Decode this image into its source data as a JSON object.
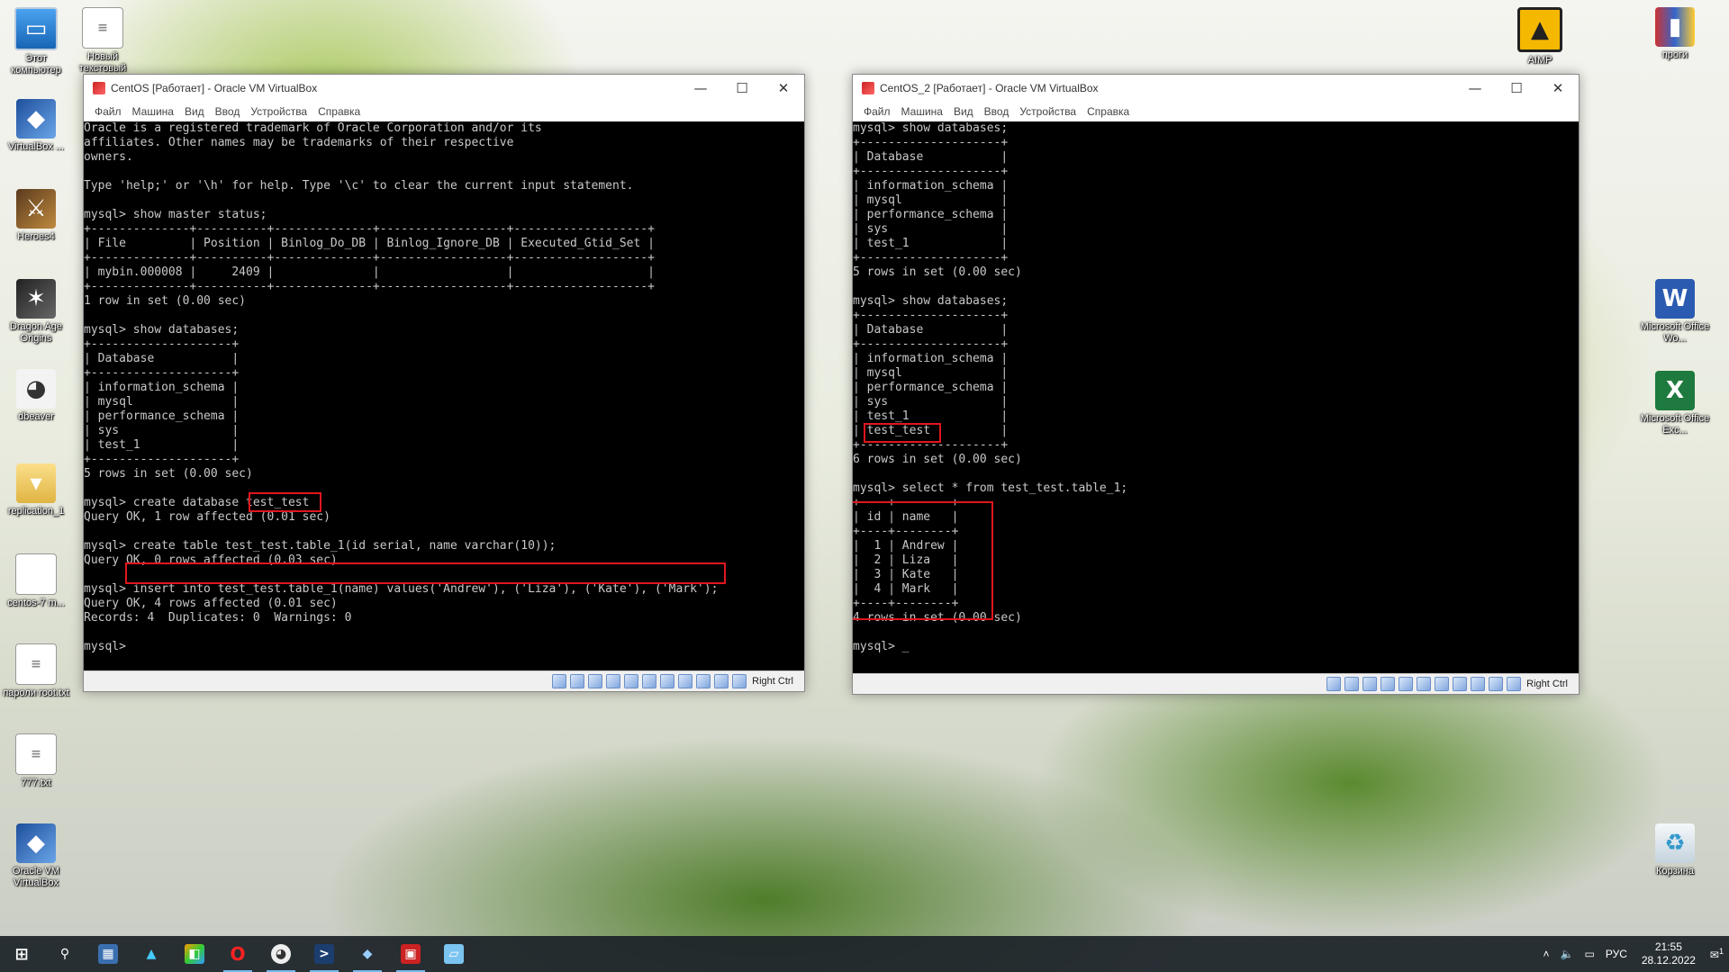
{
  "desktop": {
    "left_icons": [
      {
        "label": "Этот компьютер",
        "icon": "computer-icon"
      },
      {
        "label": "Новый текстовый",
        "icon": "text-document-icon"
      },
      {
        "label": "VirtualBox ...",
        "icon": "virtualbox-icon"
      },
      {
        "label": "Heroes4",
        "icon": "game-icon"
      },
      {
        "label": "Dragon Age Origins",
        "icon": "game-icon"
      },
      {
        "label": "dbeaver",
        "icon": "dbeaver-icon"
      },
      {
        "label": "replication_1",
        "icon": "folder-icon"
      },
      {
        "label": "centos-7 m...",
        "icon": "file-icon"
      },
      {
        "label": "пароли root.txt",
        "icon": "text-file-icon"
      },
      {
        "label": "777.txt",
        "icon": "text-file-icon"
      },
      {
        "label": "Oracle VM VirtualBox",
        "icon": "virtualbox-icon"
      }
    ],
    "right_icons": [
      {
        "label": "AIMP",
        "icon": "aimp-icon"
      },
      {
        "label": "проги",
        "icon": "folder-icon"
      },
      {
        "label": "Microsoft Office Wo...",
        "icon": "word-icon"
      },
      {
        "label": "Microsoft Office Exc...",
        "icon": "excel-icon"
      },
      {
        "label": "Корзина",
        "icon": "recycle-bin-icon"
      }
    ]
  },
  "vm1": {
    "title": "CentOS [Работает] - Oracle VM VirtualBox",
    "menu": [
      "Файл",
      "Машина",
      "Вид",
      "Ввод",
      "Устройства",
      "Справка"
    ],
    "host_key": "Right Ctrl",
    "terminal": "Oracle is a registered trademark of Oracle Corporation and/or its\naffiliates. Other names may be trademarks of their respective\nowners.\n\nType 'help;' or '\\h' for help. Type '\\c' to clear the current input statement.\n\nmysql> show master status;\n+--------------+----------+--------------+------------------+-------------------+\n| File         | Position | Binlog_Do_DB | Binlog_Ignore_DB | Executed_Gtid_Set |\n+--------------+----------+--------------+------------------+-------------------+\n| mybin.000008 |     2409 |              |                  |                   |\n+--------------+----------+--------------+------------------+-------------------+\n1 row in set (0.00 sec)\n\nmysql> show databases;\n+--------------------+\n| Database           |\n+--------------------+\n| information_schema |\n| mysql              |\n| performance_schema |\n| sys                |\n| test_1             |\n+--------------------+\n5 rows in set (0.00 sec)\n\nmysql> create database test_test\nQuery OK, 1 row affected (0.01 sec)\n\nmysql> create table test_test.table_1(id serial, name varchar(10));\nQuery OK, 0 rows affected (0.03 sec)\n\nmysql> insert into test_test.table_1(name) values('Andrew'), ('Liza'), ('Kate'), ('Mark');\nQuery OK, 4 rows affected (0.01 sec)\nRecords: 4  Duplicates: 0  Warnings: 0\n\nmysql>"
  },
  "vm2": {
    "title": "CentOS_2 [Работает] - Oracle VM VirtualBox",
    "menu": [
      "Файл",
      "Машина",
      "Вид",
      "Ввод",
      "Устройства",
      "Справка"
    ],
    "host_key": "Right Ctrl",
    "terminal": "mysql> show databases;\n+--------------------+\n| Database           |\n+--------------------+\n| information_schema |\n| mysql              |\n| performance_schema |\n| sys                |\n| test_1             |\n+--------------------+\n5 rows in set (0.00 sec)\n\nmysql> show databases;\n+--------------------+\n| Database           |\n+--------------------+\n| information_schema |\n| mysql              |\n| performance_schema |\n| sys                |\n| test_1             |\n| test_test          |\n+--------------------+\n6 rows in set (0.00 sec)\n\nmysql> select * from test_test.table_1;\n+----+--------+\n| id | name   |\n+----+--------+\n|  1 | Andrew |\n|  2 | Liza   |\n|  3 | Kate   |\n|  4 | Mark   |\n+----+--------+\n4 rows in set (0.00 sec)\n\nmysql> _"
  },
  "taskbar": {
    "apps": [
      "start-icon",
      "search-icon",
      "calculator-icon",
      "drive-icon",
      "store-icon",
      "opera-icon",
      "dbeaver-icon",
      "terminal-icon",
      "virtualbox-icon",
      "vm-icon",
      "notes-icon"
    ],
    "language": "РУС",
    "time": "21:55",
    "date": "28.12.2022",
    "notifications": "1"
  }
}
